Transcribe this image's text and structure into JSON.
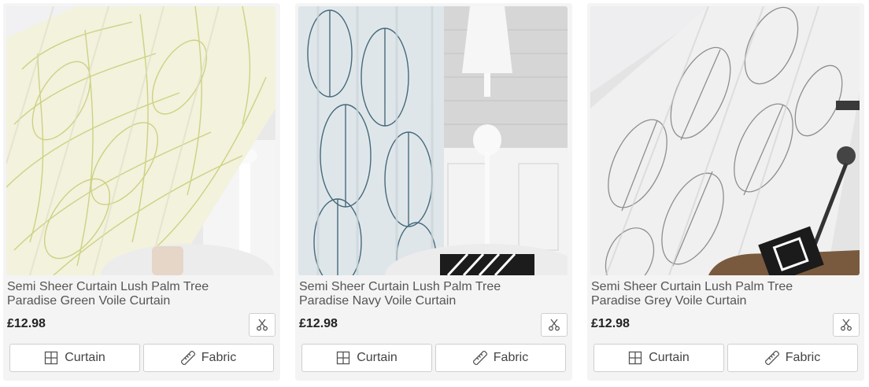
{
  "products": [
    {
      "title_line1": "Semi Sheer Curtain Lush Palm Tree",
      "title_line2": "Paradise Green Voile Curtain",
      "price": "£12.98",
      "curtain_label": "Curtain",
      "fabric_label": "Fabric",
      "colors": {
        "leaf": "#c8cf78",
        "base": "#f3f2dd",
        "wall": "#e9e9ea"
      }
    },
    {
      "title_line1": "Semi Sheer Curtain Lush Palm Tree",
      "title_line2": "Paradise Navy Voile Curtain",
      "price": "£12.98",
      "curtain_label": "Curtain",
      "fabric_label": "Fabric",
      "colors": {
        "leaf": "#456a7a",
        "base": "#dfe6ea",
        "wall": "#d6d6d6"
      }
    },
    {
      "title_line1": "Semi Sheer Curtain Lush Palm Tree",
      "title_line2": "Paradise Grey Voile Curtain",
      "price": "£12.98",
      "curtain_label": "Curtain",
      "fabric_label": "Fabric",
      "colors": {
        "leaf": "#8e8e8e",
        "base": "#f0f0f0",
        "wall": "#e4e4e4"
      }
    }
  ],
  "icons": {
    "sample": "scissors-icon",
    "curtain": "window-grid-icon",
    "fabric": "ruler-icon"
  }
}
